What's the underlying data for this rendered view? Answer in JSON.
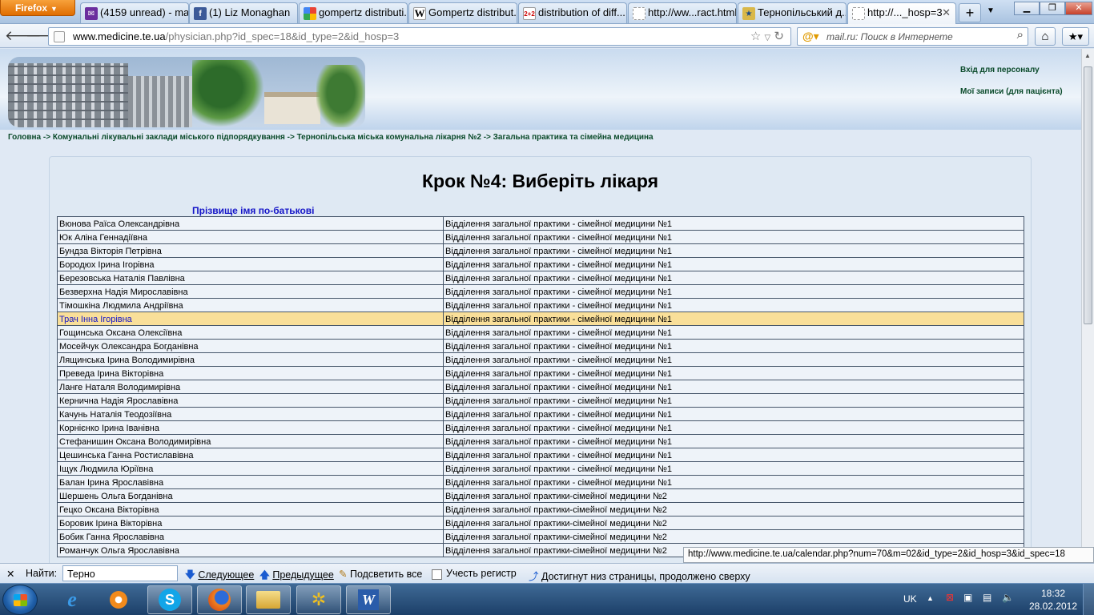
{
  "browser": {
    "menu_button": "Firefox",
    "tabs": [
      {
        "title": "(4159 unread) - ma...",
        "icon": "yahoo-mail-icon"
      },
      {
        "title": "(1) Liz Monaghan",
        "icon": "facebook-icon"
      },
      {
        "title": "gompertz distributi...",
        "icon": "google-icon"
      },
      {
        "title": "Gompertz distribut...",
        "icon": "wikipedia-icon"
      },
      {
        "title": "distribution of diff...",
        "icon": "2x2-icon"
      },
      {
        "title": "http://ww...ract.html",
        "icon": "blank-page-icon"
      },
      {
        "title": "Тернопільський д...",
        "icon": "site-icon"
      },
      {
        "title": "http://..._hosp=3",
        "icon": "blank-page-icon",
        "active": true
      }
    ],
    "url_host": "www.medicine.te.ua",
    "url_rest": "/physician.php?id_spec=18&id_type=2&id_hosp=3",
    "search_placeholder": "mail.ru: Поиск в Интернете",
    "status_url": "http://www.medicine.te.ua/calendar.php?num=70&m=02&id_type=2&id_hosp=3&id_spec=18"
  },
  "page": {
    "links": {
      "staff_login": "Вхід для персоналу",
      "my_records": "Мої записи (для пацієнта)"
    },
    "breadcrumb": "Головна -> Комунальні лікувальні заклади міського підпорядкування -> Тернопільська міська комунальна лікарня №2 -> Загальна практика та сімейна медицина",
    "heading": "Крок №4: Виберіть лікаря",
    "column_header": "Прізвище імя по-батькові",
    "doctors": [
      {
        "name": "Вюнова Раїса Олександрівна",
        "dept": "Відділення загальної практики - сімейної медицини №1"
      },
      {
        "name": "Юк Аліна Геннадіївна",
        "dept": "Відділення загальної практики - сімейної медицини №1"
      },
      {
        "name": "Бундза Вікторія Петрівна",
        "dept": "Відділення загальної практики - сімейної медицини №1"
      },
      {
        "name": "Бородюх Ірина Ігорівна",
        "dept": "Відділення загальної практики - сімейної медицини №1"
      },
      {
        "name": "Березовська Наталія Павлівна",
        "dept": "Відділення загальної практики - сімейної медицини №1"
      },
      {
        "name": "Безверхна Надія Мирославівна",
        "dept": "Відділення загальної практики - сімейної медицини №1"
      },
      {
        "name": "Тімошкіна Людмила Андріївна",
        "dept": "Відділення загальної практики - сімейної медицини №1"
      },
      {
        "name": "Трач Інна Ігорівна",
        "dept": "Відділення загальної практики - сімейної медицини №1",
        "highlight": true
      },
      {
        "name": "Гощинська Оксана Олексіївна",
        "dept": "Відділення загальної практики - сімейної медицини №1"
      },
      {
        "name": "Мосейчук Олександра Богданівна",
        "dept": "Відділення загальної практики - сімейної медицини №1"
      },
      {
        "name": "Лящинська Ірина Володимирівна",
        "dept": "Відділення загальної практики - сімейної медицини №1"
      },
      {
        "name": "Преведа Ірина Вікторівна",
        "dept": "Відділення загальної практики - сімейної медицини №1"
      },
      {
        "name": "Ланге Наталя Володимирівна",
        "dept": "Відділення загальної практики - сімейної медицини №1"
      },
      {
        "name": "Кернична Надія Ярославівна",
        "dept": "Відділення загальної практики - сімейної медицини №1"
      },
      {
        "name": "Качунь Наталія Теодозіївна",
        "dept": "Відділення загальної практики - сімейної медицини №1"
      },
      {
        "name": "Корнієнко Ірина Іванівна",
        "dept": "Відділення загальної практики - сімейної медицини №1"
      },
      {
        "name": "Стефанишин Оксана Володимирівна",
        "dept": "Відділення загальної практики - сімейної медицини №1"
      },
      {
        "name": "Цешинська Ганна Ростиславівна",
        "dept": "Відділення загальної практики - сімейної медицини №1"
      },
      {
        "name": "Іщук Людмила Юріївна",
        "dept": "Відділення загальної практики - сімейної медицини №1"
      },
      {
        "name": "Балан Ірина Ярославівна",
        "dept": "Відділення загальної практики - сімейної медицини №1"
      },
      {
        "name": "Шершень Ольга Богданівна",
        "dept": "Відділення загальної практики-сімейної медицини №2"
      },
      {
        "name": "Гецко Оксана Вікторівна",
        "dept": "Відділення загальної практики-сімейної медицини №2"
      },
      {
        "name": "Боровик Ірина Вікторівна",
        "dept": "Відділення загальної практики-сімейної медицини №2"
      },
      {
        "name": "Бобик Ганна Ярославівна",
        "dept": "Відділення загальної практики-сімейної медицини №2"
      },
      {
        "name": "Романчук Ольга Ярославівна",
        "dept": "Відділення загальної практики-сімейної медицини №2"
      }
    ]
  },
  "findbar": {
    "label": "Найти:",
    "value": "Терно",
    "next": "Следующее",
    "prev": "Предыдущее",
    "highlight_all": "Подсветить все",
    "match_case": "Учесть регистр",
    "wrap_notice": "Достигнут низ страницы, продолжено сверху"
  },
  "taskbar": {
    "items": [
      "start-icon",
      "internet-explorer-icon",
      "media-player-icon",
      "skype-icon",
      "firefox-icon",
      "file-explorer-icon",
      "app-icon",
      "word-icon"
    ],
    "lang": "UK",
    "time": "18:32",
    "date": "28.02.2012"
  },
  "colors": {
    "highlight_row": "#f9df99",
    "link_blue": "#1515c8",
    "header_green": "#0a4a2a"
  }
}
